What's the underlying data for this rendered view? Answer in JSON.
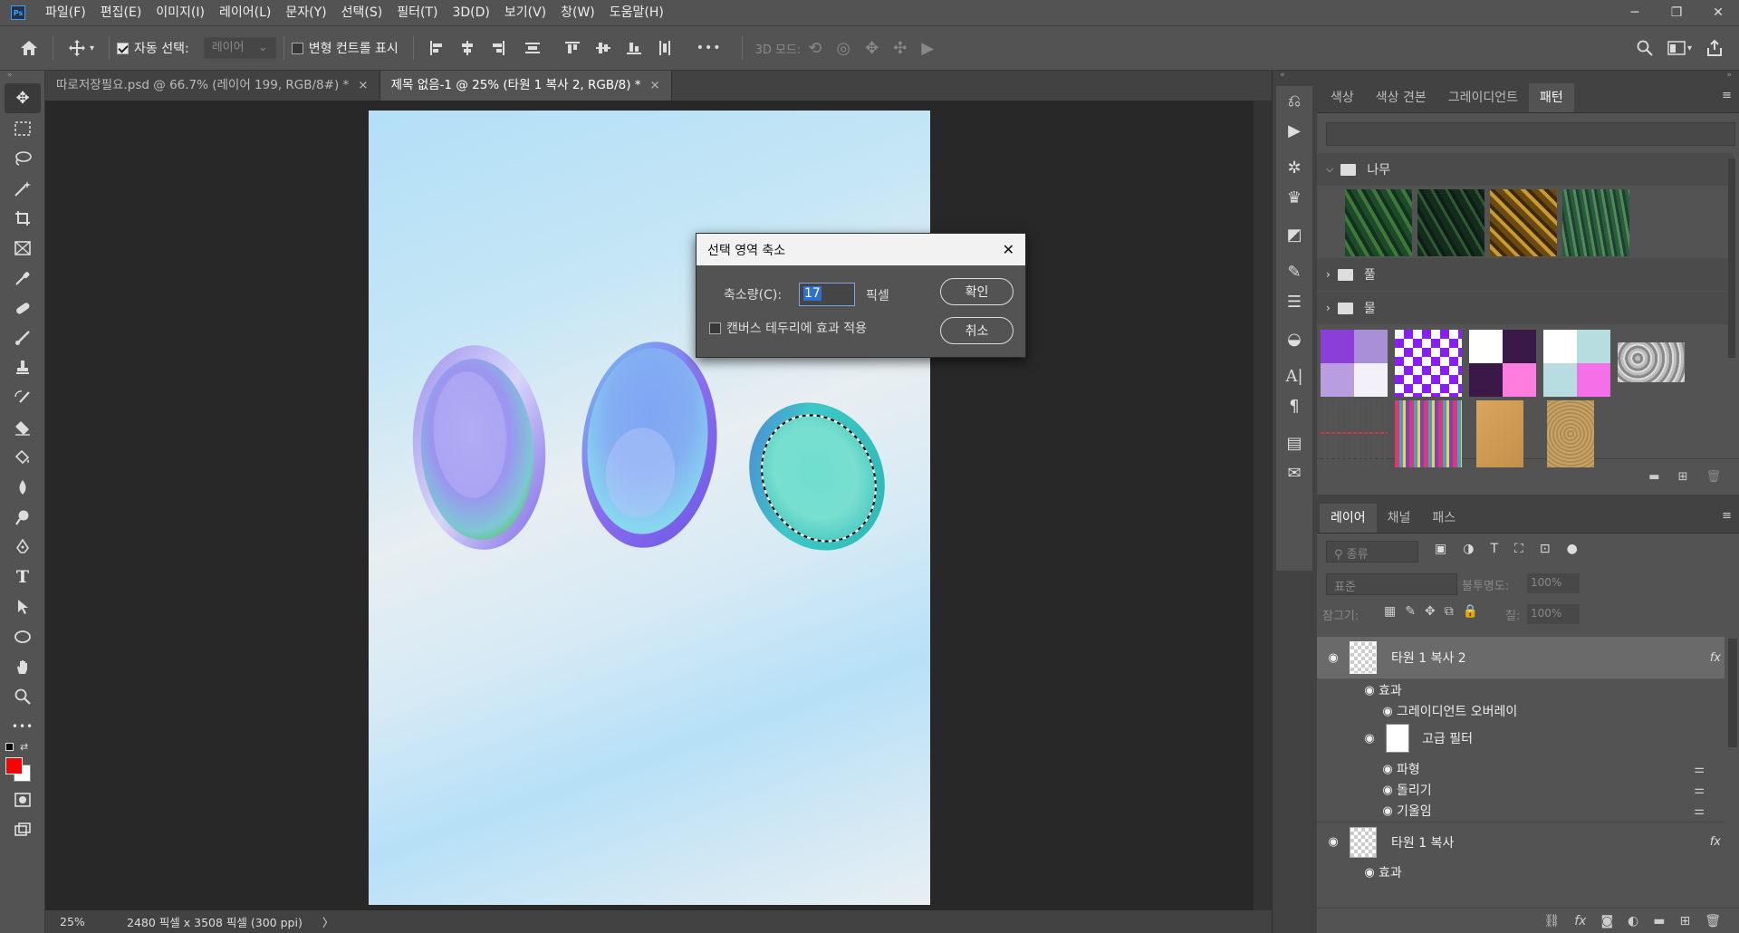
{
  "menubar": {
    "logo": "Ps",
    "items": [
      "파일(F)",
      "편집(E)",
      "이미지(I)",
      "레이어(L)",
      "문자(Y)",
      "선택(S)",
      "필터(T)",
      "3D(D)",
      "보기(V)",
      "창(W)",
      "도움말(H)"
    ],
    "win_min": "─",
    "win_restore": "❐",
    "win_close": "✕"
  },
  "optionsbar": {
    "auto_select_label": "자동 선택:",
    "auto_select_target": "레이어",
    "transform_controls_label": "변형 컨트롤 표시",
    "more_label": "•••",
    "mode_3d_label": "3D 모드:"
  },
  "tabs": [
    {
      "label": "따로저장필요.psd @ 66.7% (레이어 199, RGB/8#) *",
      "close": "×"
    },
    {
      "label": "제목 없음-1 @ 25% (타원 1 복사 2, RGB/8) *",
      "close": "×"
    }
  ],
  "statusbar": {
    "zoom": "25%",
    "doc_info": "2480 픽셀 x 3508 픽셀 (300 ppi)",
    "arrow": "〉"
  },
  "dialog": {
    "title": "선택 영역 축소",
    "close": "✕",
    "contract_label": "축소량(C):",
    "contract_value": "17",
    "unit": "픽셀",
    "canvas_edge_label": "캔버스 테두리에 효과 적용",
    "ok_label": "확인",
    "cancel_label": "취소"
  },
  "colors": {
    "foreground": "#ff0000",
    "background": "#ffffff",
    "ui_dark": "#535353",
    "ui_darker": "#424242",
    "canvas_bg": "#282828"
  },
  "swatches_panel": {
    "tabs": [
      "색상",
      "색상 견본",
      "그레이디언트",
      "패턴"
    ],
    "active_tab": "패턴",
    "groups": [
      {
        "name": "나무",
        "expanded": true
      },
      {
        "name": "풀",
        "expanded": false
      },
      {
        "name": "물",
        "expanded": false
      }
    ],
    "expand_icon": "⌵",
    "collapse_icon": "›"
  },
  "layers_panel": {
    "tabs": [
      "레이어",
      "채널",
      "패스"
    ],
    "active_tab": "레이어",
    "search_placeholder": "종류",
    "blend_mode": "표준",
    "opacity_label": "불투명도:",
    "opacity_value": "100%",
    "lock_label": "잠그기:",
    "fill_label": "칠:",
    "fill_value": "100%",
    "fx": "fx",
    "layers": [
      {
        "name": "타원 1 복사 2",
        "selected": true
      },
      {
        "name": "효과"
      },
      {
        "name": "그레이디언트 오버레이"
      },
      {
        "name": "고급 필터"
      },
      {
        "name": "파형"
      },
      {
        "name": "돌리기"
      },
      {
        "name": "기울임"
      },
      {
        "name": "타원 1 복사",
        "selected": false
      },
      {
        "name": "효과"
      }
    ]
  },
  "panel_menu_icon": "≡"
}
